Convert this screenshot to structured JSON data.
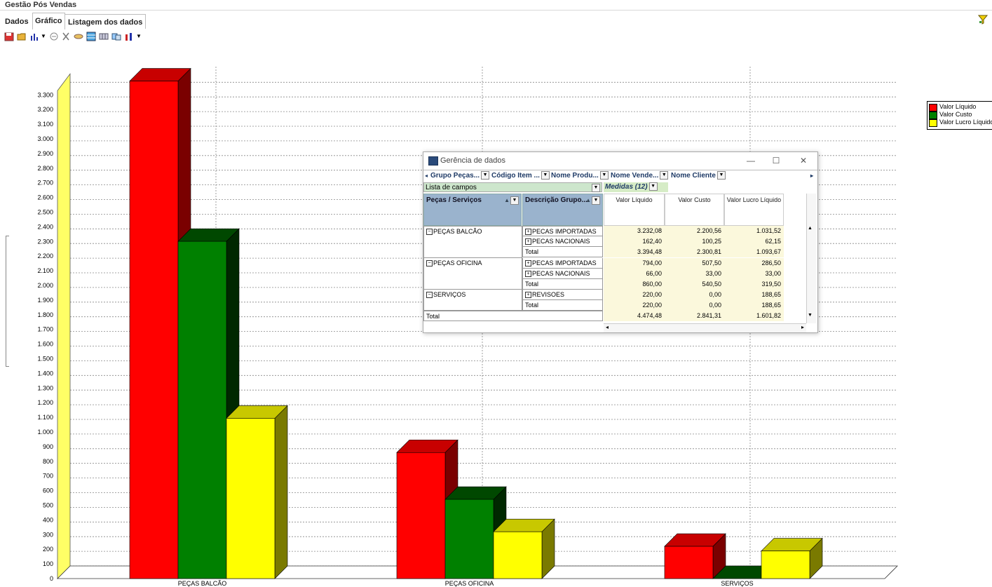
{
  "app": {
    "title": "Gestão Pós Vendas"
  },
  "tabs": [
    {
      "label": "Dados"
    },
    {
      "label": "Gráfico",
      "active": true
    },
    {
      "label": "Listagem dos dados"
    }
  ],
  "toolbar": {
    "icons": [
      "save-icon",
      "open-folder-icon",
      "bar-chart-icon",
      "chevron-down-icon",
      "print-icon",
      "cut-icon",
      "copy-icon",
      "grid-icon",
      "table-icon",
      "export-icon",
      "chart-type-icon",
      "chevron-down-icon"
    ]
  },
  "colors": {
    "valor_liquido": "#ff0000",
    "valor_custo": "#008000",
    "valor_lucro": "#ffff00",
    "axis_wall": "#ffff66"
  },
  "chart_data": {
    "type": "bar",
    "style": "3d",
    "categories": [
      "PEÇAS BALCÃO",
      "PEÇAS OFICINA",
      "SERVIÇOS"
    ],
    "series": [
      {
        "name": "Valor Líquido",
        "values": [
          3394.48,
          860.0,
          220.0
        ]
      },
      {
        "name": "Valor Custo",
        "values": [
          2300.81,
          540.5,
          0.0
        ]
      },
      {
        "name": "Valor Lucro Líquido",
        "values": [
          1093.67,
          319.5,
          188.65
        ]
      }
    ],
    "ylim": [
      0,
      3300
    ],
    "ytick_step": 100,
    "yticks": [
      "0",
      "100",
      "200",
      "300",
      "400",
      "500",
      "600",
      "700",
      "800",
      "900",
      "1.000",
      "1.100",
      "1.200",
      "1.300",
      "1.400",
      "1.500",
      "1.600",
      "1.700",
      "1.800",
      "1.900",
      "2.000",
      "2.100",
      "2.200",
      "2.300",
      "2.400",
      "2.500",
      "2.600",
      "2.700",
      "2.800",
      "2.900",
      "3.000",
      "3.100",
      "3.200",
      "3.300"
    ],
    "grid": true,
    "legend_position": "top-right"
  },
  "data_window": {
    "title": "Gerência de dados",
    "controls": {
      "minimize": "—",
      "maximize": "☐",
      "close": "✕"
    },
    "field_buttons": [
      "Grupo Peças...",
      "Código Item ...",
      "Nome Produ...",
      "Nome Vende...",
      "Nome Cliente"
    ],
    "field_list_label": "Lista de campos",
    "measures_label": "Medidas (12)",
    "row_headers": [
      "Peças / Serviços",
      "Descrição Grupo..."
    ],
    "measure_headers": [
      "Valor Líquido",
      "Valor Custo",
      "Valor Lucro Líquido"
    ],
    "groups": [
      {
        "name": "PEÇAS BALCÃO",
        "rows": [
          {
            "label": "PECAS IMPORTADAS",
            "values": [
              "3.232,08",
              "2.200,56",
              "1.031,52"
            ]
          },
          {
            "label": "PECAS NACIONAIS",
            "values": [
              "162,40",
              "100,25",
              "62,15"
            ]
          },
          {
            "label": "Total",
            "values": [
              "3.394,48",
              "2.300,81",
              "1.093,67"
            ]
          }
        ]
      },
      {
        "name": "PEÇAS OFICINA",
        "rows": [
          {
            "label": "PECAS IMPORTADAS",
            "values": [
              "794,00",
              "507,50",
              "286,50"
            ]
          },
          {
            "label": "PECAS NACIONAIS",
            "values": [
              "66,00",
              "33,00",
              "33,00"
            ]
          },
          {
            "label": "Total",
            "values": [
              "860,00",
              "540,50",
              "319,50"
            ]
          }
        ]
      },
      {
        "name": "SERVIÇOS",
        "rows": [
          {
            "label": "REVISOES",
            "values": [
              "220,00",
              "0,00",
              "188,65"
            ]
          },
          {
            "label": "Total",
            "values": [
              "220,00",
              "0,00",
              "188,65"
            ]
          }
        ]
      }
    ],
    "grand_total": {
      "label": "Total",
      "values": [
        "4.474,48",
        "2.841,31",
        "1.601,82"
      ]
    }
  }
}
